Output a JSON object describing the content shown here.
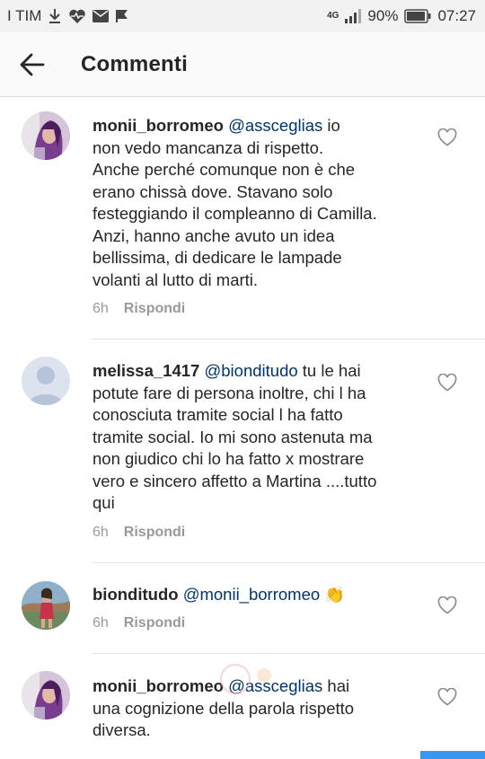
{
  "status_bar": {
    "carrier": "I TIM",
    "network": "4G",
    "battery": "90%",
    "time": "07:27",
    "icons": [
      "download-icon",
      "heart-monitor-icon",
      "mail-icon",
      "flag-icon",
      "signal-icon",
      "battery-icon"
    ]
  },
  "header": {
    "title": "Commenti",
    "back_icon": "back-arrow-icon"
  },
  "comments": [
    {
      "username": "monii_borromeo",
      "mention": "@assceglias",
      "text": " io\nnon vedo mancanza di rispetto.\nAnche perché comunque non è che\nerano chissà dove. Stavano solo\nfesteggiando il compleanno di Camilla.\nAnzi, hanno anche avuto un idea\nbellissima, di dedicare le lampade\nvolanti al lutto di marti.",
      "time": "6h",
      "reply": "Rispondi"
    },
    {
      "username": "melissa_1417",
      "mention": "@bionditudo",
      "text": " tu le hai\npotute fare di persona inoltre, chi l ha\nconosciuta tramite social l ha fatto\ntramite social. Io mi sono astenuta ma\nnon giudico chi lo ha fatto x mostrare\nvero e sincero affetto a Martina ....tutto\nqui",
      "time": "6h",
      "reply": "Rispondi"
    },
    {
      "username": "bionditudo",
      "mention": "@monii_borromeo",
      "text": " 👏",
      "time": "6h",
      "reply": "Rispondi"
    },
    {
      "username": "monii_borromeo",
      "mention": "@assceglias",
      "text": " hai\nuna cognizione della parola rispetto\ndiversa.",
      "time": "",
      "reply": ""
    }
  ],
  "colors": {
    "mention": "#003569",
    "meta": "#999999",
    "action_blue": "#3897f0"
  }
}
